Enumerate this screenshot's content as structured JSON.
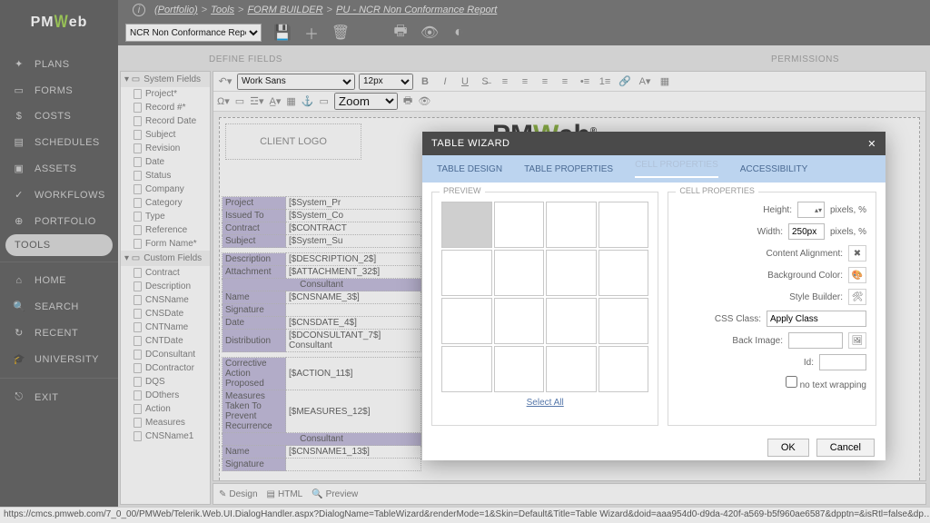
{
  "logo": {
    "pm": "PM",
    "w": "W",
    "eb": "eb"
  },
  "breadcrumb": {
    "portfolio": "(Portfolio)",
    "s1": ">",
    "tools": "Tools",
    "s2": ">",
    "fb": "FORM BUILDER",
    "s3": ">",
    "name": "PU - NCR Non Conformance Report"
  },
  "recordSelect": "NCR Non Conformance Report",
  "sidenav": [
    {
      "icon": "✦",
      "label": "PLANS"
    },
    {
      "icon": "▭",
      "label": "FORMS"
    },
    {
      "icon": "$",
      "label": "COSTS"
    },
    {
      "icon": "▤",
      "label": "SCHEDULES"
    },
    {
      "icon": "▣",
      "label": "ASSETS"
    },
    {
      "icon": "✓",
      "label": "WORKFLOWS"
    },
    {
      "icon": "⊕",
      "label": "PORTFOLIO"
    },
    {
      "icon": "",
      "label": "TOOLS",
      "active": true
    }
  ],
  "sidenav2": [
    {
      "icon": "⌂",
      "label": "HOME"
    },
    {
      "icon": "🔍",
      "label": "SEARCH"
    },
    {
      "icon": "↻",
      "label": "RECENT"
    },
    {
      "icon": "🎓",
      "label": "UNIVERSITY"
    }
  ],
  "sidenavExit": {
    "icon": "⎋",
    "label": "EXIT"
  },
  "mainTabs": {
    "a": "DEFINE FIELDS",
    "b": "PERMISSIONS"
  },
  "systemFieldsHdr": "System Fields",
  "systemFields": [
    "Project*",
    "Record #*",
    "Record Date",
    "Subject",
    "Revision",
    "Date",
    "Status",
    "Company",
    "Category",
    "Type",
    "Reference",
    "Form Name*"
  ],
  "customFieldsHdr": "Custom Fields",
  "customFields": [
    "Contract",
    "Description",
    "CNSName",
    "CNSDate",
    "CNTName",
    "CNTDate",
    "DConsultant",
    "DContractor",
    "DQS",
    "DOthers",
    "Action",
    "Measures",
    "CNSName1"
  ],
  "editorToolbar": {
    "font": "Work Sans",
    "size": "12px",
    "zoom": "Zoom"
  },
  "clientLogo": "CLIENT LOGO",
  "docLogo": {
    "pm": "PM",
    "w": "W",
    "eb": "eb",
    "r": "®"
  },
  "table1": [
    [
      "Project",
      "[$System_Pr"
    ],
    [
      "Issued To",
      "[$System_Co"
    ],
    [
      "Contract",
      "[$CONTRACT"
    ],
    [
      "Subject",
      "[$System_Su"
    ]
  ],
  "tableDesc": [
    [
      "Description",
      "[$DESCRIPTION_2$]"
    ],
    [
      "Attachment",
      "[$ATTACHMENT_32$]"
    ]
  ],
  "consultantHdr": "Consultant",
  "tableCons": [
    [
      "Name",
      "[$CNSNAME_3$]"
    ],
    [
      "Signature",
      ""
    ],
    [
      "Date",
      "[$CNSDATE_4$]"
    ],
    [
      "Distribution",
      "[$DCONSULTANT_7$]   Consultant"
    ]
  ],
  "tableAct": [
    [
      "Corrective Action Proposed",
      "[$ACTION_11$]"
    ],
    [
      "Measures Taken To Prevent Recurrence",
      "[$MEASURES_12$]"
    ]
  ],
  "tableCons2": [
    [
      "Name",
      "[$CNSNAME1_13$]"
    ],
    [
      "Signature",
      ""
    ]
  ],
  "footerTabs": {
    "design": "Design",
    "html": "HTML",
    "preview": "Preview"
  },
  "modal": {
    "title": "TABLE WIZARD",
    "close": "✕",
    "tabs": {
      "a": "TABLE DESIGN",
      "b": "TABLE PROPERTIES",
      "c": "CELL PROPERTIES",
      "d": "ACCESSIBILITY"
    },
    "previewLegend": "PREVIEW",
    "propsLegend": "CELL PROPERTIES",
    "selectAll": "Select All",
    "labels": {
      "height": "Height:",
      "width": "Width:",
      "widthVal": "250px",
      "pixpct": "pixels, %",
      "contentAlign": "Content Alignment:",
      "bg": "Background Color:",
      "style": "Style Builder:",
      "css": "CSS Class:",
      "cssVal": "Apply Class",
      "backimg": "Back Image:",
      "id": "Id:",
      "nowrap": "no text wrapping"
    },
    "ok": "OK",
    "cancel": "Cancel"
  },
  "statusbar": "https://cmcs.pmweb.com/7_0_00/PMWeb/Telerik.Web.UI.DialogHandler.aspx?DialogName=TableWizard&renderMode=1&Skin=Default&Title=Table Wizard&doid=aaa954d0-d9da-420f-a569-b5f960ae6587&dpptn=&isRtl=false&dp…"
}
